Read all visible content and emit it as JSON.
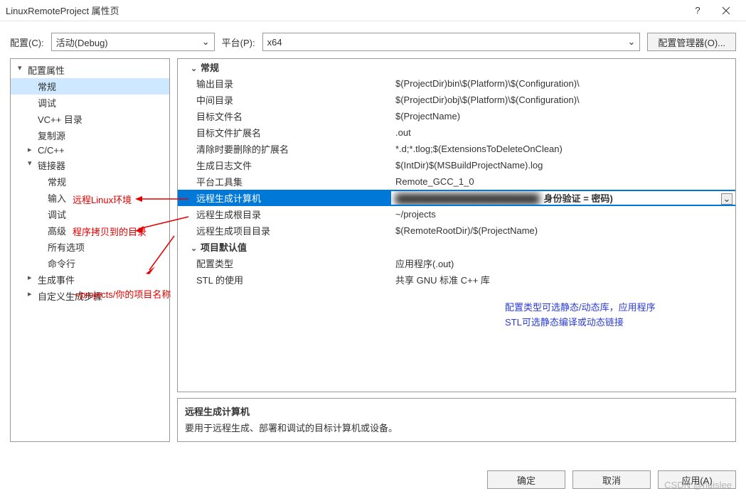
{
  "title": "LinuxRemoteProject 属性页",
  "labels": {
    "config": "配置(C):",
    "platform": "平台(P):",
    "cfgmgr": "配置管理器(O)...",
    "ok": "确定",
    "cancel": "取消",
    "apply": "应用(A)"
  },
  "config_value": "活动(Debug)",
  "platform_value": "x64",
  "tree": [
    {
      "label": "配置属性",
      "expand": "▾",
      "lvl": 0
    },
    {
      "label": "常规",
      "lvl": 1,
      "selected": true
    },
    {
      "label": "调试",
      "lvl": 1
    },
    {
      "label": "VC++ 目录",
      "lvl": 1
    },
    {
      "label": "复制源",
      "lvl": 1
    },
    {
      "label": "C/C++",
      "expand": "▸",
      "lvl": 1
    },
    {
      "label": "链接器",
      "expand": "▾",
      "lvl": 1
    },
    {
      "label": "常规",
      "lvl": 2
    },
    {
      "label": "输入",
      "lvl": 2
    },
    {
      "label": "调试",
      "lvl": 2
    },
    {
      "label": "高级",
      "lvl": 2
    },
    {
      "label": "所有选项",
      "lvl": 2
    },
    {
      "label": "命令行",
      "lvl": 2
    },
    {
      "label": "生成事件",
      "expand": "▸",
      "lvl": 1
    },
    {
      "label": "自定义生成步骤",
      "expand": "▸",
      "lvl": 1
    }
  ],
  "grid": [
    {
      "group": true,
      "label": "常规"
    },
    {
      "label": "输出目录",
      "value": "$(ProjectDir)bin\\$(Platform)\\$(Configuration)\\"
    },
    {
      "label": "中间目录",
      "value": "$(ProjectDir)obj\\$(Platform)\\$(Configuration)\\"
    },
    {
      "label": "目标文件名",
      "value": "$(ProjectName)"
    },
    {
      "label": "目标文件扩展名",
      "value": ".out"
    },
    {
      "label": "清除时要删除的扩展名",
      "value": "*.d;*.tlog;$(ExtensionsToDeleteOnClean)"
    },
    {
      "label": "生成日志文件",
      "value": "$(IntDir)$(MSBuildProjectName).log"
    },
    {
      "label": "平台工具集",
      "value": "Remote_GCC_1_0"
    },
    {
      "label": "远程生成计算机",
      "value": "",
      "selected": true,
      "masked": true,
      "suffix": "身份验证 = 密码)"
    },
    {
      "label": "远程生成根目录",
      "value": "~/projects"
    },
    {
      "label": "远程生成项目目录",
      "value": "$(RemoteRootDir)/$(ProjectName)"
    },
    {
      "group": true,
      "label": "项目默认值"
    },
    {
      "label": "配置类型",
      "value": "应用程序(.out)"
    },
    {
      "label": "STL 的使用",
      "value": "共享 GNU 标准 C++ 库"
    }
  ],
  "advisory": {
    "line1": "配置类型可选静态/动态库，应用程序",
    "line2": "STL可选静态编译或动态链接"
  },
  "desc": {
    "title": "远程生成计算机",
    "body": "要用于远程生成、部署和调试的目标计算机或设备。"
  },
  "watermark": "CSDN @huislee",
  "annotations": {
    "a1": "远程Linux环境",
    "a2": "程序拷贝到的目录",
    "a3": "~/projects/你的项目名称"
  }
}
